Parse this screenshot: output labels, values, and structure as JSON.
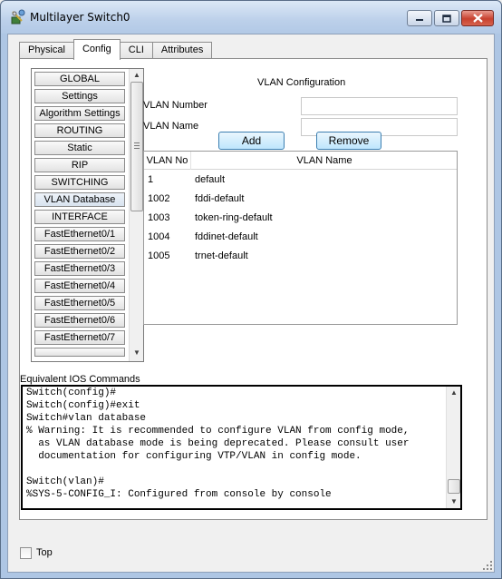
{
  "window": {
    "title": "Multilayer Switch0"
  },
  "tabs": [
    {
      "label": "Physical",
      "active": false
    },
    {
      "label": "Config",
      "active": true
    },
    {
      "label": "CLI",
      "active": false
    },
    {
      "label": "Attributes",
      "active": false
    }
  ],
  "nav": {
    "items": [
      {
        "label": "GLOBAL"
      },
      {
        "label": "Settings"
      },
      {
        "label": "Algorithm Settings"
      },
      {
        "label": "ROUTING"
      },
      {
        "label": "Static"
      },
      {
        "label": "RIP"
      },
      {
        "label": "SWITCHING"
      },
      {
        "label": "VLAN Database"
      },
      {
        "label": "INTERFACE"
      },
      {
        "label": "FastEthernet0/1"
      },
      {
        "label": "FastEthernet0/2"
      },
      {
        "label": "FastEthernet0/3"
      },
      {
        "label": "FastEthernet0/4"
      },
      {
        "label": "FastEthernet0/5"
      },
      {
        "label": "FastEthernet0/6"
      },
      {
        "label": "FastEthernet0/7"
      }
    ],
    "selected": "VLAN Database"
  },
  "vlan_config": {
    "title": "VLAN Configuration",
    "number_label": "VLAN Number",
    "number_value": "",
    "name_label": "VLAN Name",
    "name_value": "",
    "add_label": "Add",
    "remove_label": "Remove",
    "table": {
      "columns": [
        "VLAN No",
        "VLAN Name"
      ],
      "rows": [
        [
          "1",
          "default"
        ],
        [
          "1002",
          "fddi-default"
        ],
        [
          "1003",
          "token-ring-default"
        ],
        [
          "1004",
          "fddinet-default"
        ],
        [
          "1005",
          "trnet-default"
        ]
      ]
    }
  },
  "ios": {
    "label": "Equivalent IOS Commands",
    "lines": [
      "Switch(config)#",
      "Switch(config)#exit",
      "Switch#vlan database",
      "% Warning: It is recommended to configure VLAN from config mode,",
      "  as VLAN database mode is being deprecated. Please consult user",
      "  documentation for configuring VTP/VLAN in config mode.",
      "",
      "Switch(vlan)#",
      "%SYS-5-CONFIG_I: Configured from console by console"
    ]
  },
  "footer": {
    "top_label": "Top",
    "top_checked": false
  },
  "colors": {
    "button_border": "#3c7fb1",
    "close_button": "#c8412f"
  }
}
